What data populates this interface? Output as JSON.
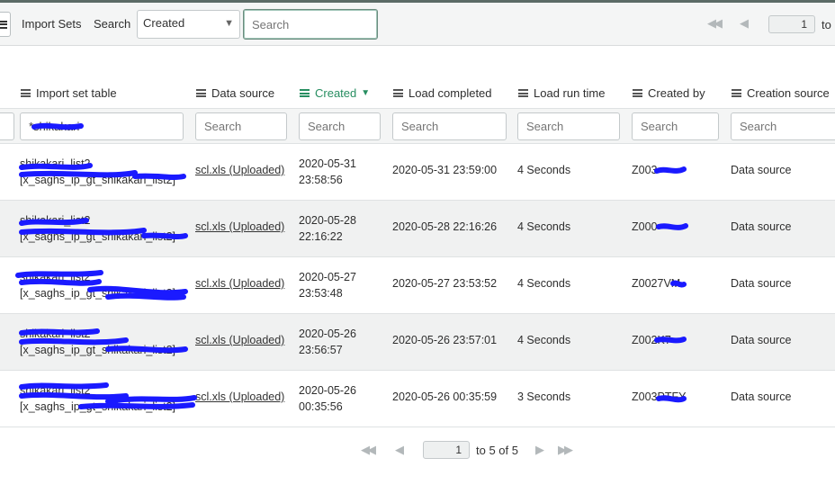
{
  "toolbar": {
    "title": "Import Sets",
    "search_label": "Search",
    "search_field": "Created",
    "search_placeholder": "Search",
    "page_number": "1",
    "page_to": "to"
  },
  "columns": [
    {
      "label": "Import set table",
      "sorted": false
    },
    {
      "label": "Data source",
      "sorted": false
    },
    {
      "label": "Created",
      "sorted": true
    },
    {
      "label": "Load completed",
      "sorted": false
    },
    {
      "label": "Load run time",
      "sorted": false
    },
    {
      "label": "Created by",
      "sorted": false
    },
    {
      "label": "Creation source",
      "sorted": false
    }
  ],
  "filters": {
    "import_set_table": "*shikakari",
    "placeholder": "Search"
  },
  "rows": [
    {
      "table_line1": "shikakari_list2",
      "table_line2": "[x_saghs_ip_gt_shikakari_list2]",
      "data_source": "scl.xls (Uploaded)",
      "created_date": "2020-05-31",
      "created_time": "23:58:56",
      "load_completed": "2020-05-31 23:59:00",
      "run_time": "4 Seconds",
      "created_by": "Z003",
      "creation_source": "Data source"
    },
    {
      "table_line1": "shikakari_list2",
      "table_line2": "[x_saghs_ip_gt_shikakari_list2]",
      "data_source": "scl.xls (Uploaded)",
      "created_date": "2020-05-28",
      "created_time": "22:16:22",
      "load_completed": "2020-05-28 22:16:26",
      "run_time": "4 Seconds",
      "created_by": "Z000",
      "creation_source": "Data source"
    },
    {
      "table_line1": "shikakari_list2",
      "table_line2": "[x_saghs_ip_gt_shikakari_list2]",
      "data_source": "scl.xls (Uploaded)",
      "created_date": "2020-05-27",
      "created_time": "23:53:48",
      "load_completed": "2020-05-27 23:53:52",
      "run_time": "4 Seconds",
      "created_by": "Z0027VM",
      "creation_source": "Data source"
    },
    {
      "table_line1": "shikakari_list2",
      "table_line2": "[x_saghs_ip_gt_shikakari_list2]",
      "data_source": "scl.xls (Uploaded)",
      "created_date": "2020-05-26",
      "created_time": "23:56:57",
      "load_completed": "2020-05-26 23:57:01",
      "run_time": "4 Seconds",
      "created_by": "Z002K7",
      "creation_source": "Data source"
    },
    {
      "table_line1": "shikakari_list2",
      "table_line2": "[x_saghs_ip_gt_shikakari_list2]",
      "data_source": "scl.xls (Uploaded)",
      "created_date": "2020-05-26",
      "created_time": "00:35:56",
      "load_completed": "2020-05-26 00:35:59",
      "run_time": "3 Seconds",
      "created_by": "Z003PTFY",
      "creation_source": "Data source"
    }
  ],
  "pager": {
    "page_number": "1",
    "range_text": "to 5 of 5"
  },
  "colors": {
    "accent": "#278e61",
    "redaction": "#1a1aff"
  }
}
